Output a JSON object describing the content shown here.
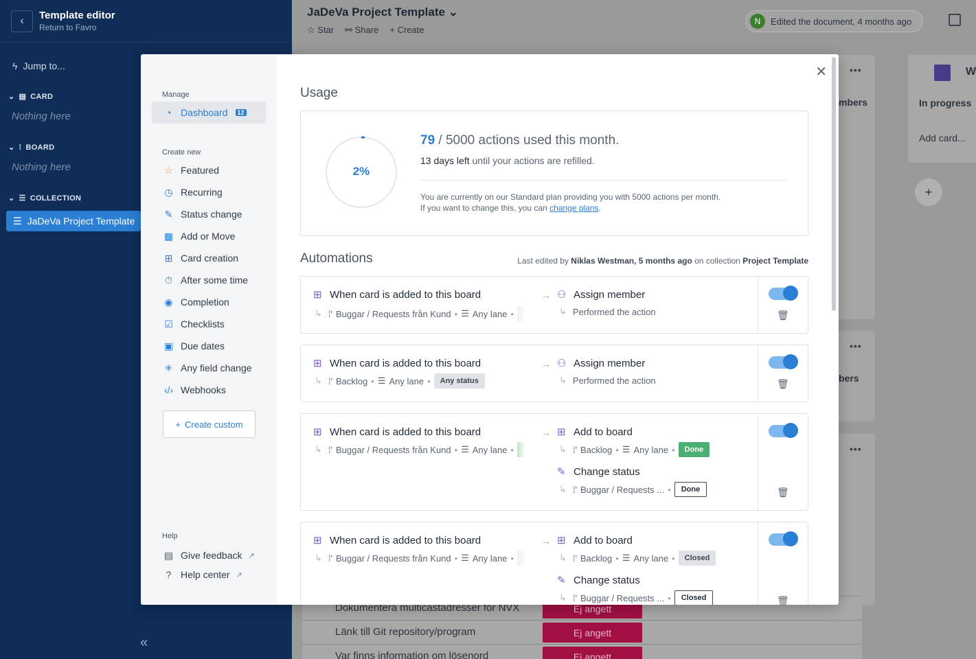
{
  "sidebar": {
    "title": "Template editor",
    "subtitle": "Return to Favro",
    "jump": "Jump to...",
    "sections": [
      {
        "label": "CARD",
        "empty": "Nothing here"
      },
      {
        "label": "BOARD",
        "empty": "Nothing here"
      },
      {
        "label": "COLLECTION"
      }
    ],
    "collection_item": "JaDeVa Project Template"
  },
  "header": {
    "title": "JaDeVa Project Template",
    "actions": [
      "Star",
      "Share",
      "Create"
    ],
    "avatar_initial": "N",
    "edited": "Edited the document, 4 months ago"
  },
  "background": {
    "col_header_1": "mbers",
    "col_header_2": "bers",
    "col_title": "In progress",
    "add_card": "Add card...",
    "col_letter": "W",
    "rows": [
      {
        "text": "Dokumentera multicastadresser för NVX",
        "status": "Ej angett"
      },
      {
        "text": "Länk till Git repository/program",
        "status": "Ej angett"
      },
      {
        "text": "Var finns information om lösenord",
        "status": "Ej angett"
      }
    ]
  },
  "modal": {
    "nav": {
      "manage_label": "Manage",
      "dashboard": "Dashboard",
      "dashboard_badge": "12",
      "create_new_label": "Create new",
      "items": [
        "Featured",
        "Recurring",
        "Status change",
        "Add or Move",
        "Card creation",
        "After some time",
        "Completion",
        "Checklists",
        "Due dates",
        "Any field change",
        "Webhooks"
      ],
      "create_custom": "Create custom",
      "help_label": "Help",
      "help_items": [
        "Give feedback",
        "Help center"
      ]
    },
    "usage": {
      "heading": "Usage",
      "percent_text": "2%",
      "percent_value": 0.0158,
      "used": "79",
      "total_text": "/ 5000 actions used this month.",
      "days_left": "13 days left",
      "refill_text": "until your actions are refilled.",
      "note1": "You are currently on our Standard plan providing you with 5000 actions per month.",
      "note2_prefix": "If you want to change this, you can",
      "note2_link": "change plans",
      "note2_suffix": "."
    },
    "automations": {
      "heading": "Automations",
      "last_edited_prefix": "Last edited by",
      "last_edited_by": "Niklas Westman, 5 months ago",
      "last_edited_mid": "on collection",
      "last_edited_collection": "Project Template",
      "cards": [
        {
          "trigger": "When card is added to this board",
          "board": "Buggar / Requests från Kund",
          "lane": "Any lane",
          "action1": "Assign member",
          "action1_sub": "Performed the action"
        },
        {
          "trigger": "When card is added to this board",
          "board": "Backlog",
          "lane": "Any lane",
          "status": "Any status",
          "action1": "Assign member",
          "action1_sub": "Performed the action"
        },
        {
          "trigger": "When card is added to this board",
          "board": "Buggar / Requests från Kund",
          "lane": "Any lane",
          "action1": "Add to board",
          "action1_board": "Backlog",
          "action1_lane": "Any lane",
          "action1_status": "Done",
          "action2": "Change status",
          "action2_board": "Buggar / Requests ...",
          "action2_status": "Done"
        },
        {
          "trigger": "When card is added to this board",
          "board": "Buggar / Requests från Kund",
          "lane": "Any lane",
          "action1": "Add to board",
          "action1_board": "Backlog",
          "action1_lane": "Any lane",
          "action1_status": "Closed",
          "action2": "Change status",
          "action2_board": "Buggar / Requests ...",
          "action2_status": "Closed"
        }
      ]
    }
  },
  "colors": {
    "accent": "#2a7fd4",
    "sidebar": "#0f2d57",
    "done": "#4caf73",
    "pill": "#a10f45"
  }
}
